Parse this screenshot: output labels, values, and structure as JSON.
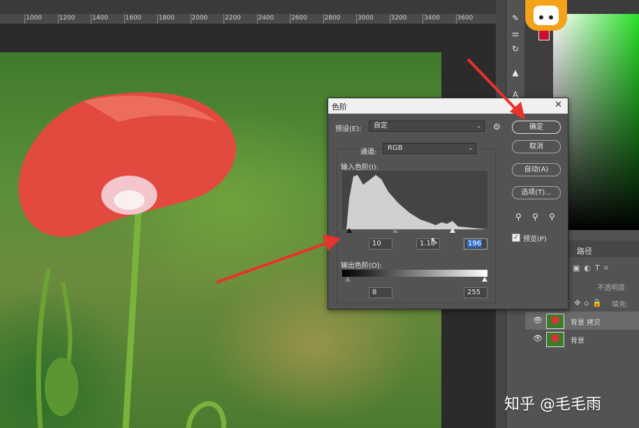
{
  "ruler": {
    "marks": [
      "1000",
      "1200",
      "1400",
      "1600",
      "1800",
      "2000",
      "2200",
      "2400",
      "2600",
      "2800",
      "3000",
      "3200",
      "3400",
      "3600"
    ]
  },
  "levels_dialog": {
    "title": "色阶",
    "preset_label": "预设(E):",
    "preset_value": "自定",
    "channel_label": "通道:",
    "channel_value": "RGB",
    "input_levels_label": "输入色阶(I):",
    "input_black": "10",
    "input_gamma": "1.16",
    "input_white": "196",
    "output_levels_label": "输出色阶(O):",
    "output_black": "8",
    "output_white": "255",
    "ok_label": "确定",
    "cancel_label": "取消",
    "auto_label": "自动(A)",
    "options_label": "选项(T)...",
    "preview_label": "预览(P)",
    "preview_checked": true
  },
  "layers": {
    "paths_tab": "路径",
    "opacity_label": "不透明度:",
    "fill_label": "填充:",
    "items": [
      {
        "name": "背景 拷贝"
      },
      {
        "name": "背景"
      }
    ]
  },
  "watermark": "知乎 @毛毛雨",
  "colors": {
    "accent_arrow": "#e8322c",
    "foreground_swatch": "#c8102e"
  }
}
